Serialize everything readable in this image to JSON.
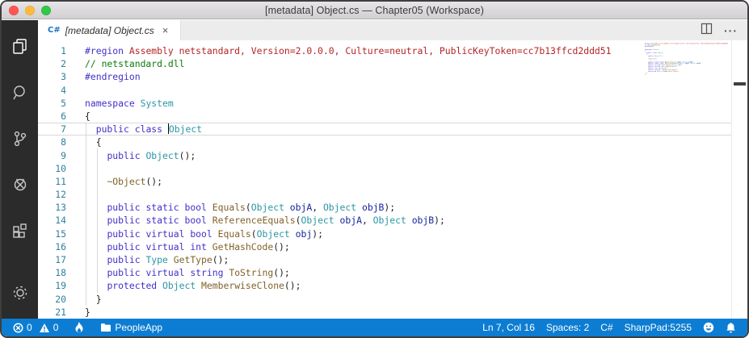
{
  "window": {
    "title": "[metadata] Object.cs — Chapter05 (Workspace)"
  },
  "window_controls": {
    "close": "close",
    "minimize": "minimize",
    "zoom": "zoom"
  },
  "tab": {
    "icon": "C#",
    "label": "[metadata] Object.cs",
    "close": "×"
  },
  "tab_actions": {
    "more": "···"
  },
  "activity_bar": {
    "items": [
      "explorer",
      "search",
      "source-control",
      "debug",
      "extensions"
    ],
    "bottom": [
      "settings"
    ]
  },
  "editor": {
    "cursor_line": 7,
    "cursor_position": "Ln 7, Col 16",
    "lines": [
      {
        "n": 1,
        "tokens": [
          [
            "kw",
            "#region"
          ],
          [
            "re",
            " Assembly netstandard, Version=2.0.0.0, Culture=neutral, PublicKeyToken=cc7b13ffcd2ddd51"
          ]
        ]
      },
      {
        "n": 2,
        "tokens": [
          [
            "co",
            "// netstandard.dll"
          ]
        ]
      },
      {
        "n": 3,
        "tokens": [
          [
            "kw",
            "#endregion"
          ]
        ]
      },
      {
        "n": 4,
        "tokens": []
      },
      {
        "n": 5,
        "tokens": [
          [
            "kw",
            "namespace"
          ],
          [
            "pl",
            " "
          ],
          [
            "ty",
            "System"
          ]
        ]
      },
      {
        "n": 6,
        "tokens": [
          [
            "pl",
            "{"
          ]
        ]
      },
      {
        "n": 7,
        "tokens": [
          [
            "pl",
            "  "
          ],
          [
            "kw",
            "public"
          ],
          [
            "pl",
            " "
          ],
          [
            "kw",
            "class"
          ],
          [
            "pl",
            " "
          ],
          [
            "cursor",
            ""
          ],
          [
            "ty",
            "Object"
          ]
        ]
      },
      {
        "n": 8,
        "tokens": [
          [
            "pl",
            "  {"
          ]
        ]
      },
      {
        "n": 9,
        "tokens": [
          [
            "pl",
            "    "
          ],
          [
            "kw",
            "public"
          ],
          [
            "pl",
            " "
          ],
          [
            "ty",
            "Object"
          ],
          [
            "pl",
            "();"
          ]
        ]
      },
      {
        "n": 10,
        "tokens": []
      },
      {
        "n": 11,
        "tokens": [
          [
            "pl",
            "    "
          ],
          [
            "me",
            "~Object"
          ],
          [
            "pl",
            "();"
          ]
        ]
      },
      {
        "n": 12,
        "tokens": []
      },
      {
        "n": 13,
        "tokens": [
          [
            "pl",
            "    "
          ],
          [
            "kw",
            "public"
          ],
          [
            "pl",
            " "
          ],
          [
            "kw",
            "static"
          ],
          [
            "pl",
            " "
          ],
          [
            "kw",
            "bool"
          ],
          [
            "pl",
            " "
          ],
          [
            "me",
            "Equals"
          ],
          [
            "pl",
            "("
          ],
          [
            "ty",
            "Object"
          ],
          [
            "pl",
            " "
          ],
          [
            "va",
            "objA"
          ],
          [
            "pl",
            ", "
          ],
          [
            "ty",
            "Object"
          ],
          [
            "pl",
            " "
          ],
          [
            "va",
            "objB"
          ],
          [
            "pl",
            ");"
          ]
        ]
      },
      {
        "n": 14,
        "tokens": [
          [
            "pl",
            "    "
          ],
          [
            "kw",
            "public"
          ],
          [
            "pl",
            " "
          ],
          [
            "kw",
            "static"
          ],
          [
            "pl",
            " "
          ],
          [
            "kw",
            "bool"
          ],
          [
            "pl",
            " "
          ],
          [
            "me",
            "ReferenceEquals"
          ],
          [
            "pl",
            "("
          ],
          [
            "ty",
            "Object"
          ],
          [
            "pl",
            " "
          ],
          [
            "va",
            "objA"
          ],
          [
            "pl",
            ", "
          ],
          [
            "ty",
            "Object"
          ],
          [
            "pl",
            " "
          ],
          [
            "va",
            "objB"
          ],
          [
            "pl",
            ");"
          ]
        ]
      },
      {
        "n": 15,
        "tokens": [
          [
            "pl",
            "    "
          ],
          [
            "kw",
            "public"
          ],
          [
            "pl",
            " "
          ],
          [
            "kw",
            "virtual"
          ],
          [
            "pl",
            " "
          ],
          [
            "kw",
            "bool"
          ],
          [
            "pl",
            " "
          ],
          [
            "me",
            "Equals"
          ],
          [
            "pl",
            "("
          ],
          [
            "ty",
            "Object"
          ],
          [
            "pl",
            " "
          ],
          [
            "va",
            "obj"
          ],
          [
            "pl",
            ");"
          ]
        ]
      },
      {
        "n": 16,
        "tokens": [
          [
            "pl",
            "    "
          ],
          [
            "kw",
            "public"
          ],
          [
            "pl",
            " "
          ],
          [
            "kw",
            "virtual"
          ],
          [
            "pl",
            " "
          ],
          [
            "kw",
            "int"
          ],
          [
            "pl",
            " "
          ],
          [
            "me",
            "GetHashCode"
          ],
          [
            "pl",
            "();"
          ]
        ]
      },
      {
        "n": 17,
        "tokens": [
          [
            "pl",
            "    "
          ],
          [
            "kw",
            "public"
          ],
          [
            "pl",
            " "
          ],
          [
            "ty",
            "Type"
          ],
          [
            "pl",
            " "
          ],
          [
            "me",
            "GetType"
          ],
          [
            "pl",
            "();"
          ]
        ]
      },
      {
        "n": 18,
        "tokens": [
          [
            "pl",
            "    "
          ],
          [
            "kw",
            "public"
          ],
          [
            "pl",
            " "
          ],
          [
            "kw",
            "virtual"
          ],
          [
            "pl",
            " "
          ],
          [
            "kw",
            "string"
          ],
          [
            "pl",
            " "
          ],
          [
            "me",
            "ToString"
          ],
          [
            "pl",
            "();"
          ]
        ]
      },
      {
        "n": 19,
        "tokens": [
          [
            "pl",
            "    "
          ],
          [
            "kw",
            "protected"
          ],
          [
            "pl",
            " "
          ],
          [
            "ty",
            "Object"
          ],
          [
            "pl",
            " "
          ],
          [
            "me",
            "MemberwiseClone"
          ],
          [
            "pl",
            "();"
          ]
        ]
      },
      {
        "n": 20,
        "tokens": [
          [
            "pl",
            "  }"
          ]
        ]
      },
      {
        "n": 21,
        "tokens": [
          [
            "pl",
            "}"
          ]
        ]
      }
    ]
  },
  "status_bar": {
    "errors": "0",
    "warnings": "0",
    "folder": "PeopleApp",
    "line_col": "Ln 7, Col 16",
    "spaces": "Spaces: 2",
    "language": "C#",
    "sharppad": "SharpPad:5255"
  },
  "colors": {
    "statusbar": "#0c7dd3",
    "kw": "#4230c9",
    "ty": "#2a96a5",
    "me": "#81622a",
    "va": "#15259c",
    "co": "#0c7d0c",
    "re": "#b42525",
    "pl": "#1f1f1f",
    "lineno": "#2f7f9f"
  }
}
